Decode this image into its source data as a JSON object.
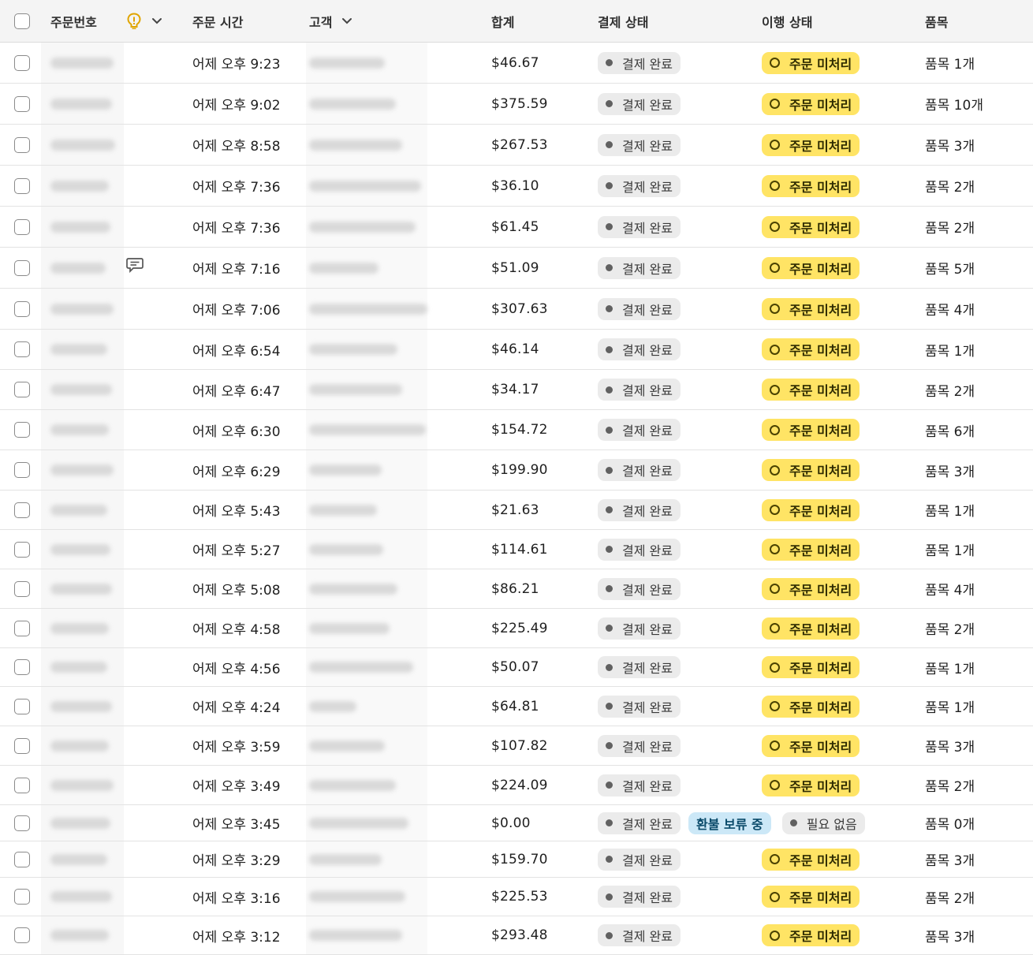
{
  "header": {
    "order_number": "주문번호",
    "order_time": "주문 시간",
    "customer": "고객",
    "total": "합계",
    "payment_status": "결제 상태",
    "fulfillment_status": "이행 상태",
    "items": "품목"
  },
  "colors": {
    "fulfillment_badge": "#ffe465",
    "payment_badge": "#ebebeb",
    "refund_badge": "#cce8f7",
    "header_bg": "#f4f4f4",
    "alert_icon": "#e0a500"
  },
  "rows": [
    {
      "time": "어제 오후 9:23",
      "total": "$46.67",
      "payment": "결제 완료",
      "fulfillment": "주문 미처리",
      "items": "품목 1개"
    },
    {
      "time": "어제 오후 9:02",
      "total": "$375.59",
      "payment": "결제 완료",
      "fulfillment": "주문 미처리",
      "items": "품목 10개"
    },
    {
      "time": "어제 오후 8:58",
      "total": "$267.53",
      "payment": "결제 완료",
      "fulfillment": "주문 미처리",
      "items": "품목 3개"
    },
    {
      "time": "어제 오후 7:36",
      "total": "$36.10",
      "payment": "결제 완료",
      "fulfillment": "주문 미처리",
      "items": "품목 2개"
    },
    {
      "time": "어제 오후 7:36",
      "total": "$61.45",
      "payment": "결제 완료",
      "fulfillment": "주문 미처리",
      "items": "품목 2개"
    },
    {
      "time": "어제 오후 7:16",
      "total": "$51.09",
      "payment": "결제 완료",
      "fulfillment": "주문 미처리",
      "items": "품목 5개",
      "note": true
    },
    {
      "time": "어제 오후 7:06",
      "total": "$307.63",
      "payment": "결제 완료",
      "fulfillment": "주문 미처리",
      "items": "품목 4개"
    },
    {
      "time": "어제 오후 6:54",
      "total": "$46.14",
      "payment": "결제 완료",
      "fulfillment": "주문 미처리",
      "items": "품목 1개"
    },
    {
      "time": "어제 오후 6:47",
      "total": "$34.17",
      "payment": "결제 완료",
      "fulfillment": "주문 미처리",
      "items": "품목 2개"
    },
    {
      "time": "어제 오후 6:30",
      "total": "$154.72",
      "payment": "결제 완료",
      "fulfillment": "주문 미처리",
      "items": "품목 6개"
    },
    {
      "time": "어제 오후 6:29",
      "total": "$199.90",
      "payment": "결제 완료",
      "fulfillment": "주문 미처리",
      "items": "품목 3개"
    },
    {
      "time": "어제 오후 5:43",
      "total": "$21.63",
      "payment": "결제 완료",
      "fulfillment": "주문 미처리",
      "items": "품목 1개"
    },
    {
      "time": "어제 오후 5:27",
      "total": "$114.61",
      "payment": "결제 완료",
      "fulfillment": "주문 미처리",
      "items": "품목 1개"
    },
    {
      "time": "어제 오후 5:08",
      "total": "$86.21",
      "payment": "결제 완료",
      "fulfillment": "주문 미처리",
      "items": "품목 4개"
    },
    {
      "time": "어제 오후 4:58",
      "total": "$225.49",
      "payment": "결제 완료",
      "fulfillment": "주문 미처리",
      "items": "품목 2개"
    },
    {
      "time": "어제 오후 4:56",
      "total": "$50.07",
      "payment": "결제 완료",
      "fulfillment": "주문 미처리",
      "items": "품목 1개"
    },
    {
      "time": "어제 오후 4:24",
      "total": "$64.81",
      "payment": "결제 완료",
      "fulfillment": "주문 미처리",
      "items": "품목 1개"
    },
    {
      "time": "어제 오후 3:59",
      "total": "$107.82",
      "payment": "결제 완료",
      "fulfillment": "주문 미처리",
      "items": "품목 3개"
    },
    {
      "time": "어제 오후 3:49",
      "total": "$224.09",
      "payment": "결제 완료",
      "fulfillment": "주문 미처리",
      "items": "품목 2개"
    },
    {
      "time": "어제 오후 3:45",
      "total": "$0.00",
      "payment": "결제 완료",
      "refund": "환불 보류 중",
      "fulfillment_none": "필요 없음",
      "items": "품목 0개"
    },
    {
      "time": "어제 오후 3:29",
      "total": "$159.70",
      "payment": "결제 완료",
      "fulfillment": "주문 미처리",
      "items": "품목 3개"
    },
    {
      "time": "어제 오후 3:16",
      "total": "$225.53",
      "payment": "결제 완료",
      "fulfillment": "주문 미처리",
      "items": "품목 2개"
    },
    {
      "time": "어제 오후 3:12",
      "total": "$293.48",
      "payment": "결제 완료",
      "fulfillment": "주문 미처리",
      "items": "품목 3개"
    }
  ]
}
